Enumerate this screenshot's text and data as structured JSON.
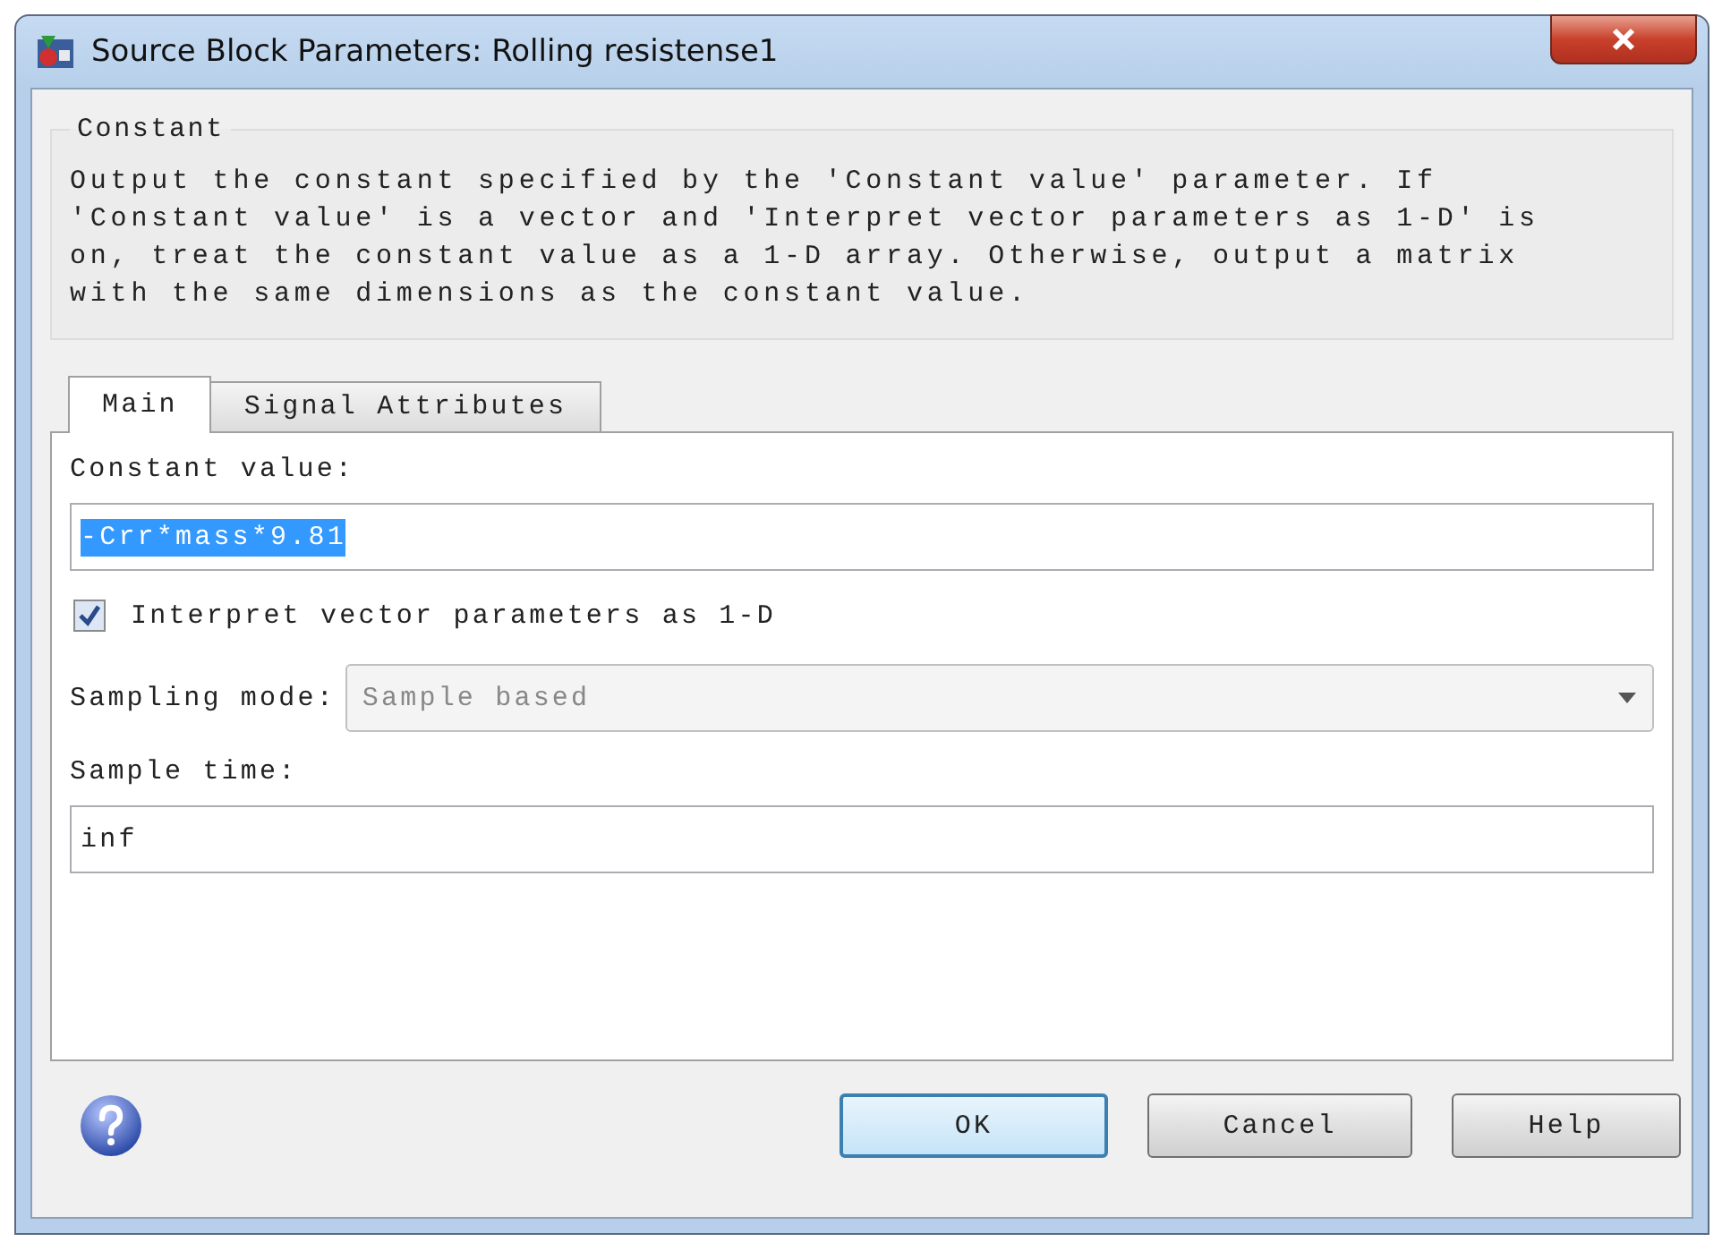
{
  "window": {
    "title": "Source Block Parameters: Rolling resistense1"
  },
  "group": {
    "title": "Constant",
    "description": "Output the constant specified by the 'Constant value' parameter. If\n'Constant value' is a vector and 'Interpret vector parameters as 1-D' is\non, treat the constant value as a 1-D array. Otherwise, output a matrix\nwith the same dimensions as the constant value."
  },
  "tabs": [
    {
      "label": "Main",
      "selected": true
    },
    {
      "label": "Signal Attributes",
      "selected": false
    }
  ],
  "fields": [
    {
      "kind": "text",
      "label": "Constant value:",
      "value": "-Crr*mass*9.81",
      "text_selected": true
    },
    {
      "kind": "checkbox",
      "label": "Interpret vector parameters as 1-D",
      "checked": true
    },
    {
      "kind": "dropdown",
      "label": "Sampling mode:",
      "value": "Sample based",
      "disabled": true
    },
    {
      "kind": "text",
      "label": "Sample time:",
      "value": "inf",
      "text_selected": false
    }
  ],
  "buttons": [
    {
      "label": "OK",
      "default": true
    },
    {
      "label": "Cancel",
      "default": false
    },
    {
      "label": "Help",
      "default": false
    }
  ]
}
